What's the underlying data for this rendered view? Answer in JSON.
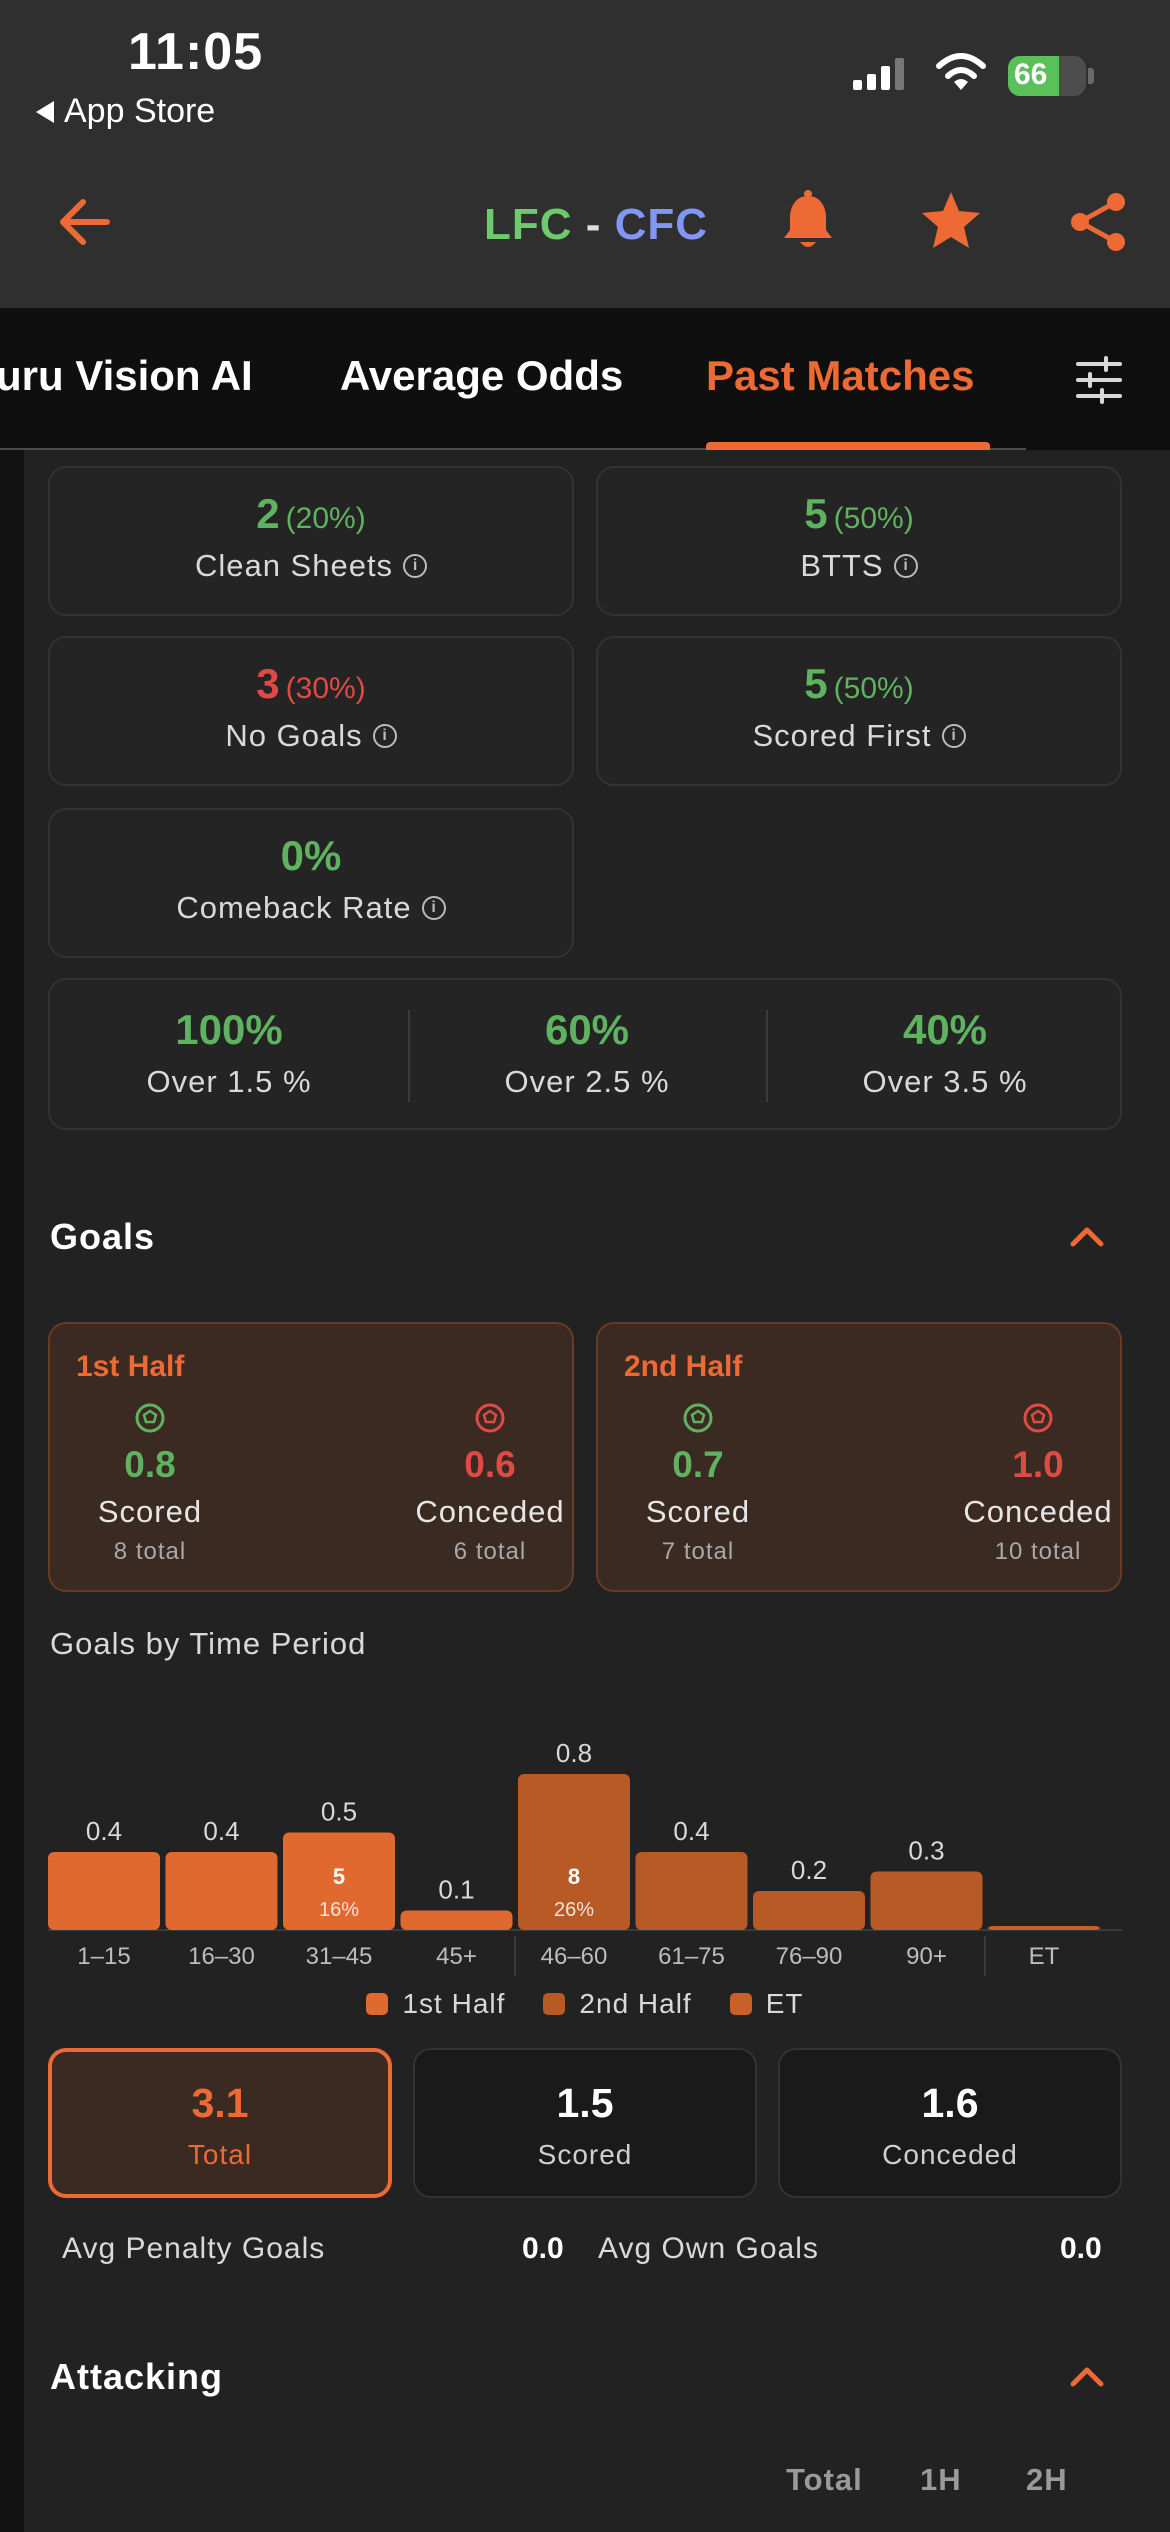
{
  "status_bar": {
    "time": "11:05",
    "back_label": "App Store",
    "battery": "66",
    "battery_level": 0.66
  },
  "nav": {
    "home_team": "LFC",
    "separator": "-",
    "away_team": "CFC",
    "home_color": "#6ccb6c",
    "away_color": "#8196f5",
    "accent_color": "#ee6a35",
    "icons": [
      "back-arrow-icon",
      "bell-icon",
      "star-icon",
      "share-icon"
    ]
  },
  "tabs": [
    {
      "label": "uru Vision AI"
    },
    {
      "label": "Average Odds"
    },
    {
      "label": "Past Matches"
    }
  ],
  "stats": [
    {
      "value": "2",
      "pct": "(20%)",
      "label": "Clean Sheets",
      "color": "green"
    },
    {
      "value": "5",
      "pct": "(50%)",
      "label": "BTTS",
      "color": "green"
    },
    {
      "value": "3",
      "pct": "(30%)",
      "label": "No Goals",
      "color": "red"
    },
    {
      "value": "5",
      "pct": "(50%)",
      "label": "Scored First",
      "color": "green"
    },
    {
      "value": "0%",
      "pct": "",
      "label": "Comeback Rate",
      "color": "green"
    }
  ],
  "overs": [
    {
      "value": "100%",
      "label": "Over 1.5 %"
    },
    {
      "value": "60%",
      "label": "Over 2.5 %"
    },
    {
      "value": "40%",
      "label": "Over 3.5 %"
    }
  ],
  "goals": {
    "title": "Goals",
    "halves": [
      {
        "title": "1st Half",
        "scored": "0.8",
        "scored_label": "Scored",
        "scored_total": "8 total",
        "conceded": "0.6",
        "conceded_label": "Conceded",
        "conceded_total": "6 total"
      },
      {
        "title": "2nd Half",
        "scored": "0.7",
        "scored_label": "Scored",
        "scored_total": "7 total",
        "conceded": "1.0",
        "conceded_label": "Conceded",
        "conceded_total": "10 total"
      }
    ],
    "by_period_title": "Goals by Time Period",
    "legend": [
      {
        "label": "1st Half",
        "color": "#e0692f"
      },
      {
        "label": "2nd Half",
        "color": "#b85a26"
      },
      {
        "label": "ET",
        "color": "#c9602a"
      }
    ],
    "summary": [
      {
        "value": "3.1",
        "label": "Total"
      },
      {
        "value": "1.5",
        "label": "Scored"
      },
      {
        "value": "1.6",
        "label": "Conceded"
      }
    ],
    "avg_penalty_label": "Avg Penalty Goals",
    "avg_penalty_value": "0.0",
    "avg_own_label": "Avg Own Goals",
    "avg_own_value": "0.0"
  },
  "chart_data": {
    "type": "bar",
    "categories": [
      "1–15",
      "16–30",
      "31–45",
      "45+",
      "46–60",
      "61–75",
      "76–90",
      "90+",
      "ET"
    ],
    "values": [
      0.4,
      0.4,
      0.5,
      0.1,
      0.8,
      0.4,
      0.2,
      0.3,
      0.0
    ],
    "value_labels": [
      "0.4",
      "0.4",
      "0.5",
      "0.1",
      "0.8",
      "0.4",
      "0.2",
      "0.3",
      ""
    ],
    "half": [
      "1st Half",
      "1st Half",
      "1st Half",
      "1st Half",
      "2nd Half",
      "2nd Half",
      "2nd Half",
      "2nd Half",
      "ET"
    ],
    "highlights": [
      {
        "category": "31–45",
        "count": "5",
        "pct": "16%"
      },
      {
        "category": "46–60",
        "count": "8",
        "pct": "26%"
      }
    ],
    "title": "Goals by Time Period",
    "ylim": [
      0,
      0.8
    ]
  },
  "attacking": {
    "title": "Attacking",
    "columns": [
      "Total",
      "1H",
      "2H"
    ]
  }
}
